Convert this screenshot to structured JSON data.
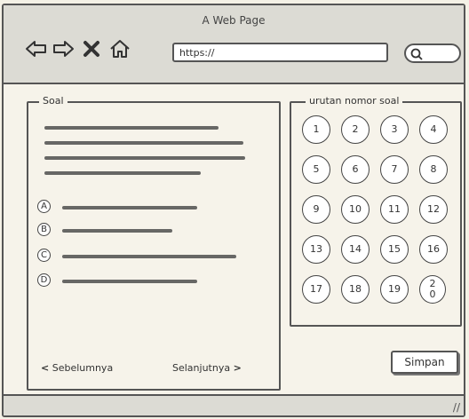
{
  "window": {
    "title": "A Web Page"
  },
  "toolbar": {
    "url": "https://",
    "icons": [
      "back-arrow-icon",
      "forward-arrow-icon",
      "close-x-icon",
      "home-icon",
      "search-icon"
    ]
  },
  "soal": {
    "legend": "Soal",
    "options": [
      "A",
      "B",
      "C",
      "D"
    ],
    "prev_label": "Sebelumnya",
    "next_label": "Selanjutnya"
  },
  "urutan": {
    "legend": "urutan nomor soal",
    "numbers": [
      "1",
      "2",
      "3",
      "4",
      "5",
      "6",
      "7",
      "8",
      "9",
      "10",
      "11",
      "12",
      "13",
      "14",
      "15",
      "16",
      "17",
      "18",
      "19",
      "20"
    ]
  },
  "save_label": "Simpan"
}
